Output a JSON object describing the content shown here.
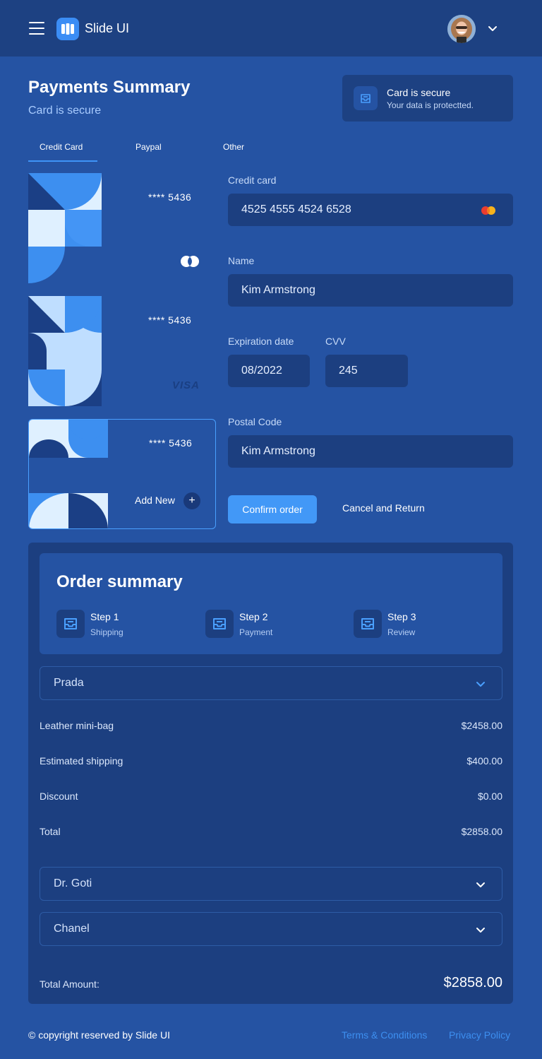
{
  "header": {
    "app_title": "Slide UI",
    "icons": {
      "menu": "hamburger-icon",
      "logo": "logo-icon",
      "avatar_dropdown": "chevron-down-icon"
    }
  },
  "page": {
    "title": "Payments Summary",
    "subtitle": "Card is secure"
  },
  "secure_notice": {
    "title": "Card is secure",
    "subtitle": "Your data is protectted.",
    "icon": "inbox-icon"
  },
  "tabs": [
    {
      "label": "Credit Card",
      "active": true
    },
    {
      "label": "Paypal",
      "active": false
    },
    {
      "label": "Other",
      "active": false
    }
  ],
  "cards": [
    {
      "number": "**** 5436",
      "brand": "mastercard"
    },
    {
      "number": "**** 5436",
      "brand": "VISA"
    },
    {
      "number": "**** 5436",
      "add_label": "Add New",
      "add_symbol": "+"
    }
  ],
  "form": {
    "credit_card": {
      "label": "Credit card",
      "value": "4525 4555 4524 6528"
    },
    "name": {
      "label": "Name",
      "value": "Kim Armstrong"
    },
    "expiration": {
      "label": "Expiration date",
      "value": "08/2022"
    },
    "cvv": {
      "label": "CVV",
      "value": "245"
    },
    "postal": {
      "label": "Postal Code",
      "value": "Kim Armstrong"
    },
    "confirm_label": "Confirm order",
    "cancel_label": "Cancel and Return"
  },
  "order": {
    "title": "Order summary",
    "steps": [
      {
        "title": "Step 1",
        "subtitle": "Shipping"
      },
      {
        "title": "Step 2",
        "subtitle": "Payment"
      },
      {
        "title": "Step 3",
        "subtitle": "Review"
      }
    ],
    "dropdowns": [
      "Prada",
      "Dr. Goti",
      "Chanel"
    ],
    "rows": [
      {
        "label": "Leather mini-bag",
        "value": "$2458.00"
      },
      {
        "label": "Estimated shipping",
        "value": "$400.00"
      },
      {
        "label": "Discount",
        "value": "$0.00"
      },
      {
        "label": "Total",
        "value": "$2858.00"
      }
    ],
    "total_label": "Total Amount:",
    "total_value": "$2858.00"
  },
  "footer": {
    "copyright": "© copyright reserved by Slide UI",
    "terms": "Terms & Conditions",
    "privacy": "Privacy Policy"
  },
  "colors": {
    "background": "#2553a3",
    "panel": "#1c3f80",
    "topbar": "#1d4182",
    "accent": "#4298f7",
    "link": "#3d8ff0"
  }
}
